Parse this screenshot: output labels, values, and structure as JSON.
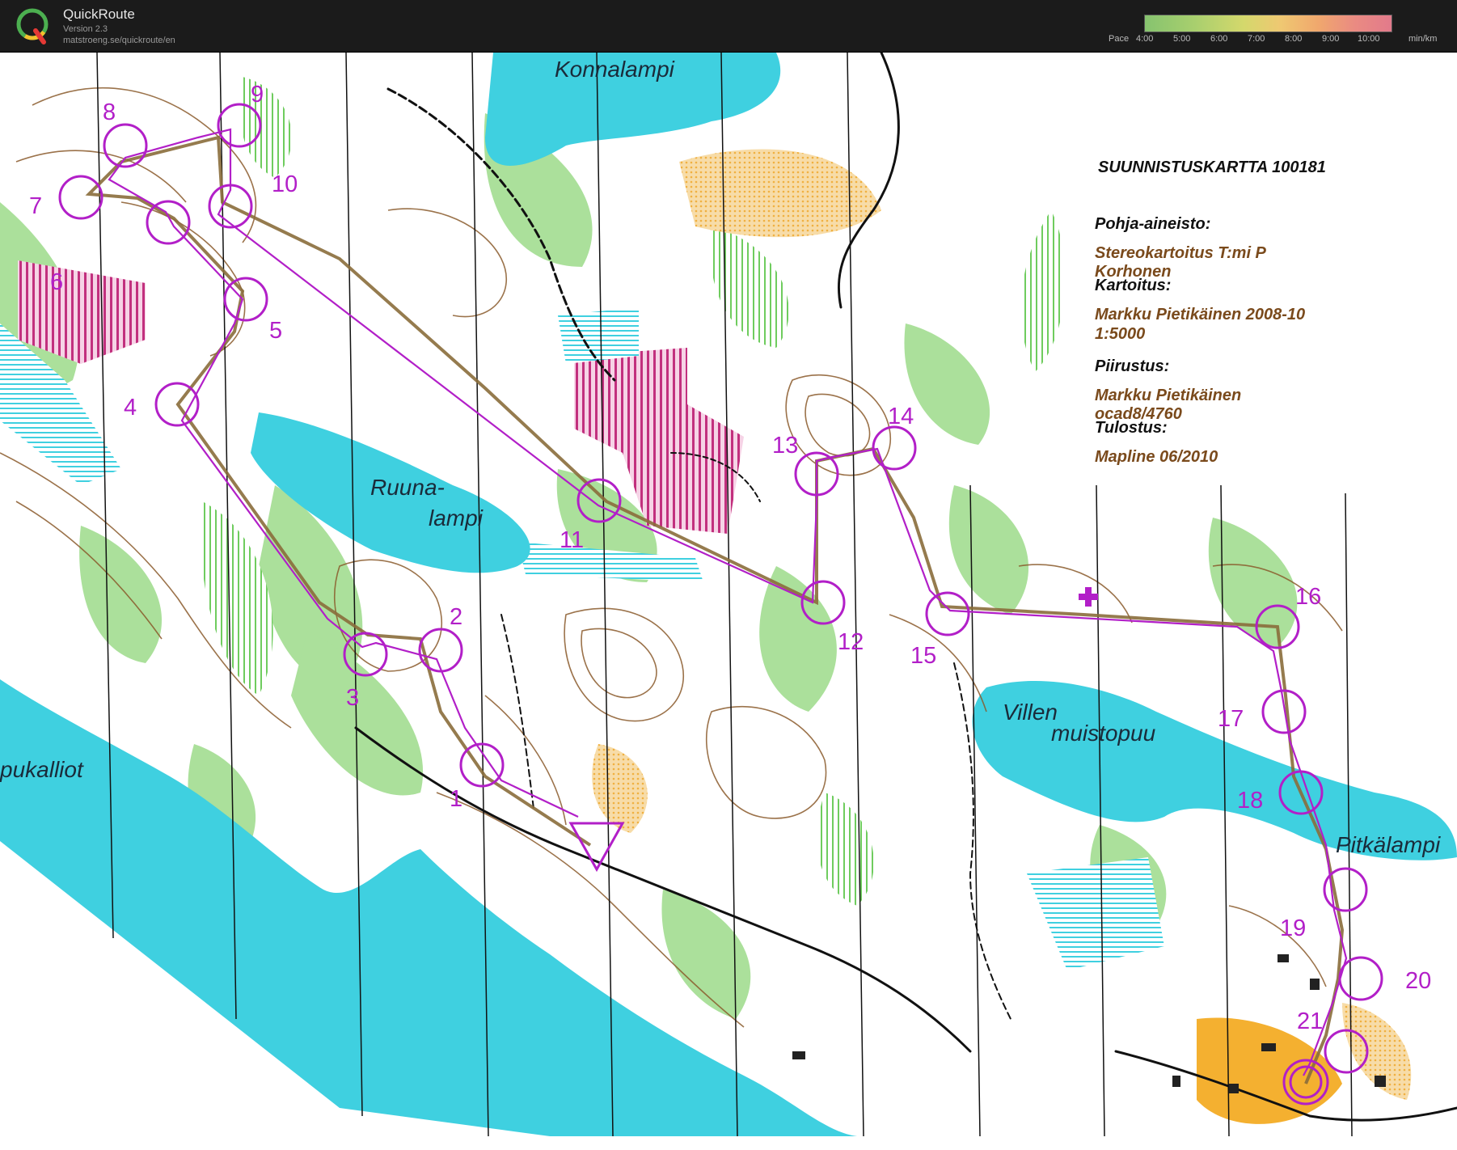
{
  "app": {
    "name": "QuickRoute",
    "version": "Version 2.3",
    "url": "matstroeng.se/quickroute/en",
    "logo_letter": "Q"
  },
  "pace_legend": {
    "label": "Pace",
    "ticks": [
      "4:00",
      "5:00",
      "6:00",
      "7:00",
      "8:00",
      "9:00",
      "10:00"
    ],
    "unit": "min/km",
    "colors": [
      "#86c36f",
      "#d4d86c",
      "#f0a86d",
      "#e27a8b"
    ]
  },
  "map_info": {
    "title": "SUUNNISTUSKARTTA 100181",
    "base_label": "Pohja-aineisto:",
    "base_value": "Stereokartoitus T:mi P Korhonen",
    "mapping_label": "Kartoitus:",
    "mapping_value": "Markku Pietikäinen 2008-10",
    "scale": "1:5000",
    "drawing_label": "Piirustus:",
    "drawing_value": "Markku Pietikäinen ocad8/4760",
    "printing_label": "Tulostus:",
    "printing_value": "Mapline 06/2010"
  },
  "place_names": {
    "konnalampi": "Konnalampi",
    "ruuna1": "Ruuna-",
    "ruuna2": "lampi",
    "villen1": "Villen",
    "villen2": "muistopuu",
    "pitkalampi": "Pitkälampi",
    "pukalliot": "pukalliot"
  },
  "controls": [
    "1",
    "2",
    "3",
    "4",
    "5",
    "6",
    "7",
    "8",
    "9",
    "10",
    "11",
    "12",
    "13",
    "14",
    "15",
    "16",
    "17",
    "18",
    "19",
    "20",
    "21"
  ],
  "colors": {
    "course": "#b21fc8",
    "route": "#8a6d3b",
    "water": "#3fd0e0",
    "forest": "#ffffff",
    "green": "#8fd67a",
    "open": "#f4c36a",
    "contour": "#8a5a2b"
  }
}
